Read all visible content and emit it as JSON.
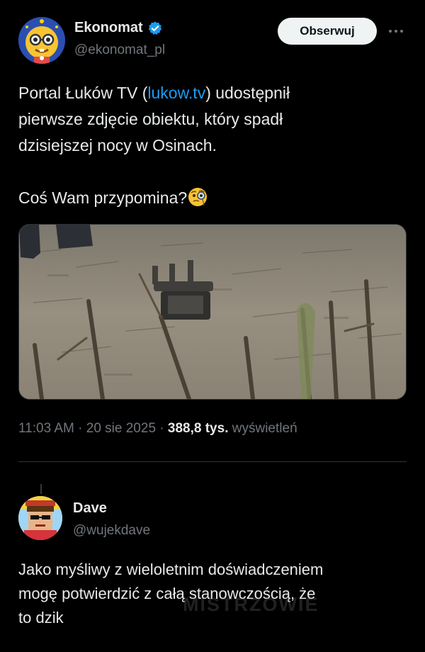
{
  "post": {
    "author": {
      "name": "Ekonomat",
      "handle": "@ekonomat_pl",
      "verified": true,
      "avatar_icon": "nerd-face-avatar"
    },
    "follow_label": "Obserwuj",
    "more_icon": "more-dots-icon",
    "text": {
      "line1_before": "Portal Łuków TV (",
      "link": "lukow.tv",
      "line1_after": ") udostępnił",
      "line2": "pierwsze zdjęcie obiektu, który spadł",
      "line3": "dzisiejszej nocy w Osinach.",
      "line4": "Coś Wam przypomina?",
      "emoji": "monocle-face-emoji"
    },
    "media": {
      "type": "photo",
      "description_icon": "photo-drone-in-field"
    },
    "meta": {
      "time": "11:03 AM",
      "date": "20 sie 2025",
      "views_count": "388,8 tys.",
      "views_label": "wyświetleń"
    }
  },
  "reply": {
    "author": {
      "name": "Dave",
      "handle": "@wujekdave",
      "avatar_icon": "pixel-dave-avatar"
    },
    "text": {
      "line1": "Jako myśliwy z wieloletnim doświadczeniem",
      "line2": "mogę potwierdzić z całą stanowczością,  że",
      "line3": "to dzik"
    }
  },
  "watermark": "MISTRZOWIE",
  "colors": {
    "background": "#000000",
    "text": "#e7e9ea",
    "secondary": "#71767b",
    "link": "#1d9bf0",
    "verified": "#1d9bf0",
    "divider": "#2f3336"
  }
}
